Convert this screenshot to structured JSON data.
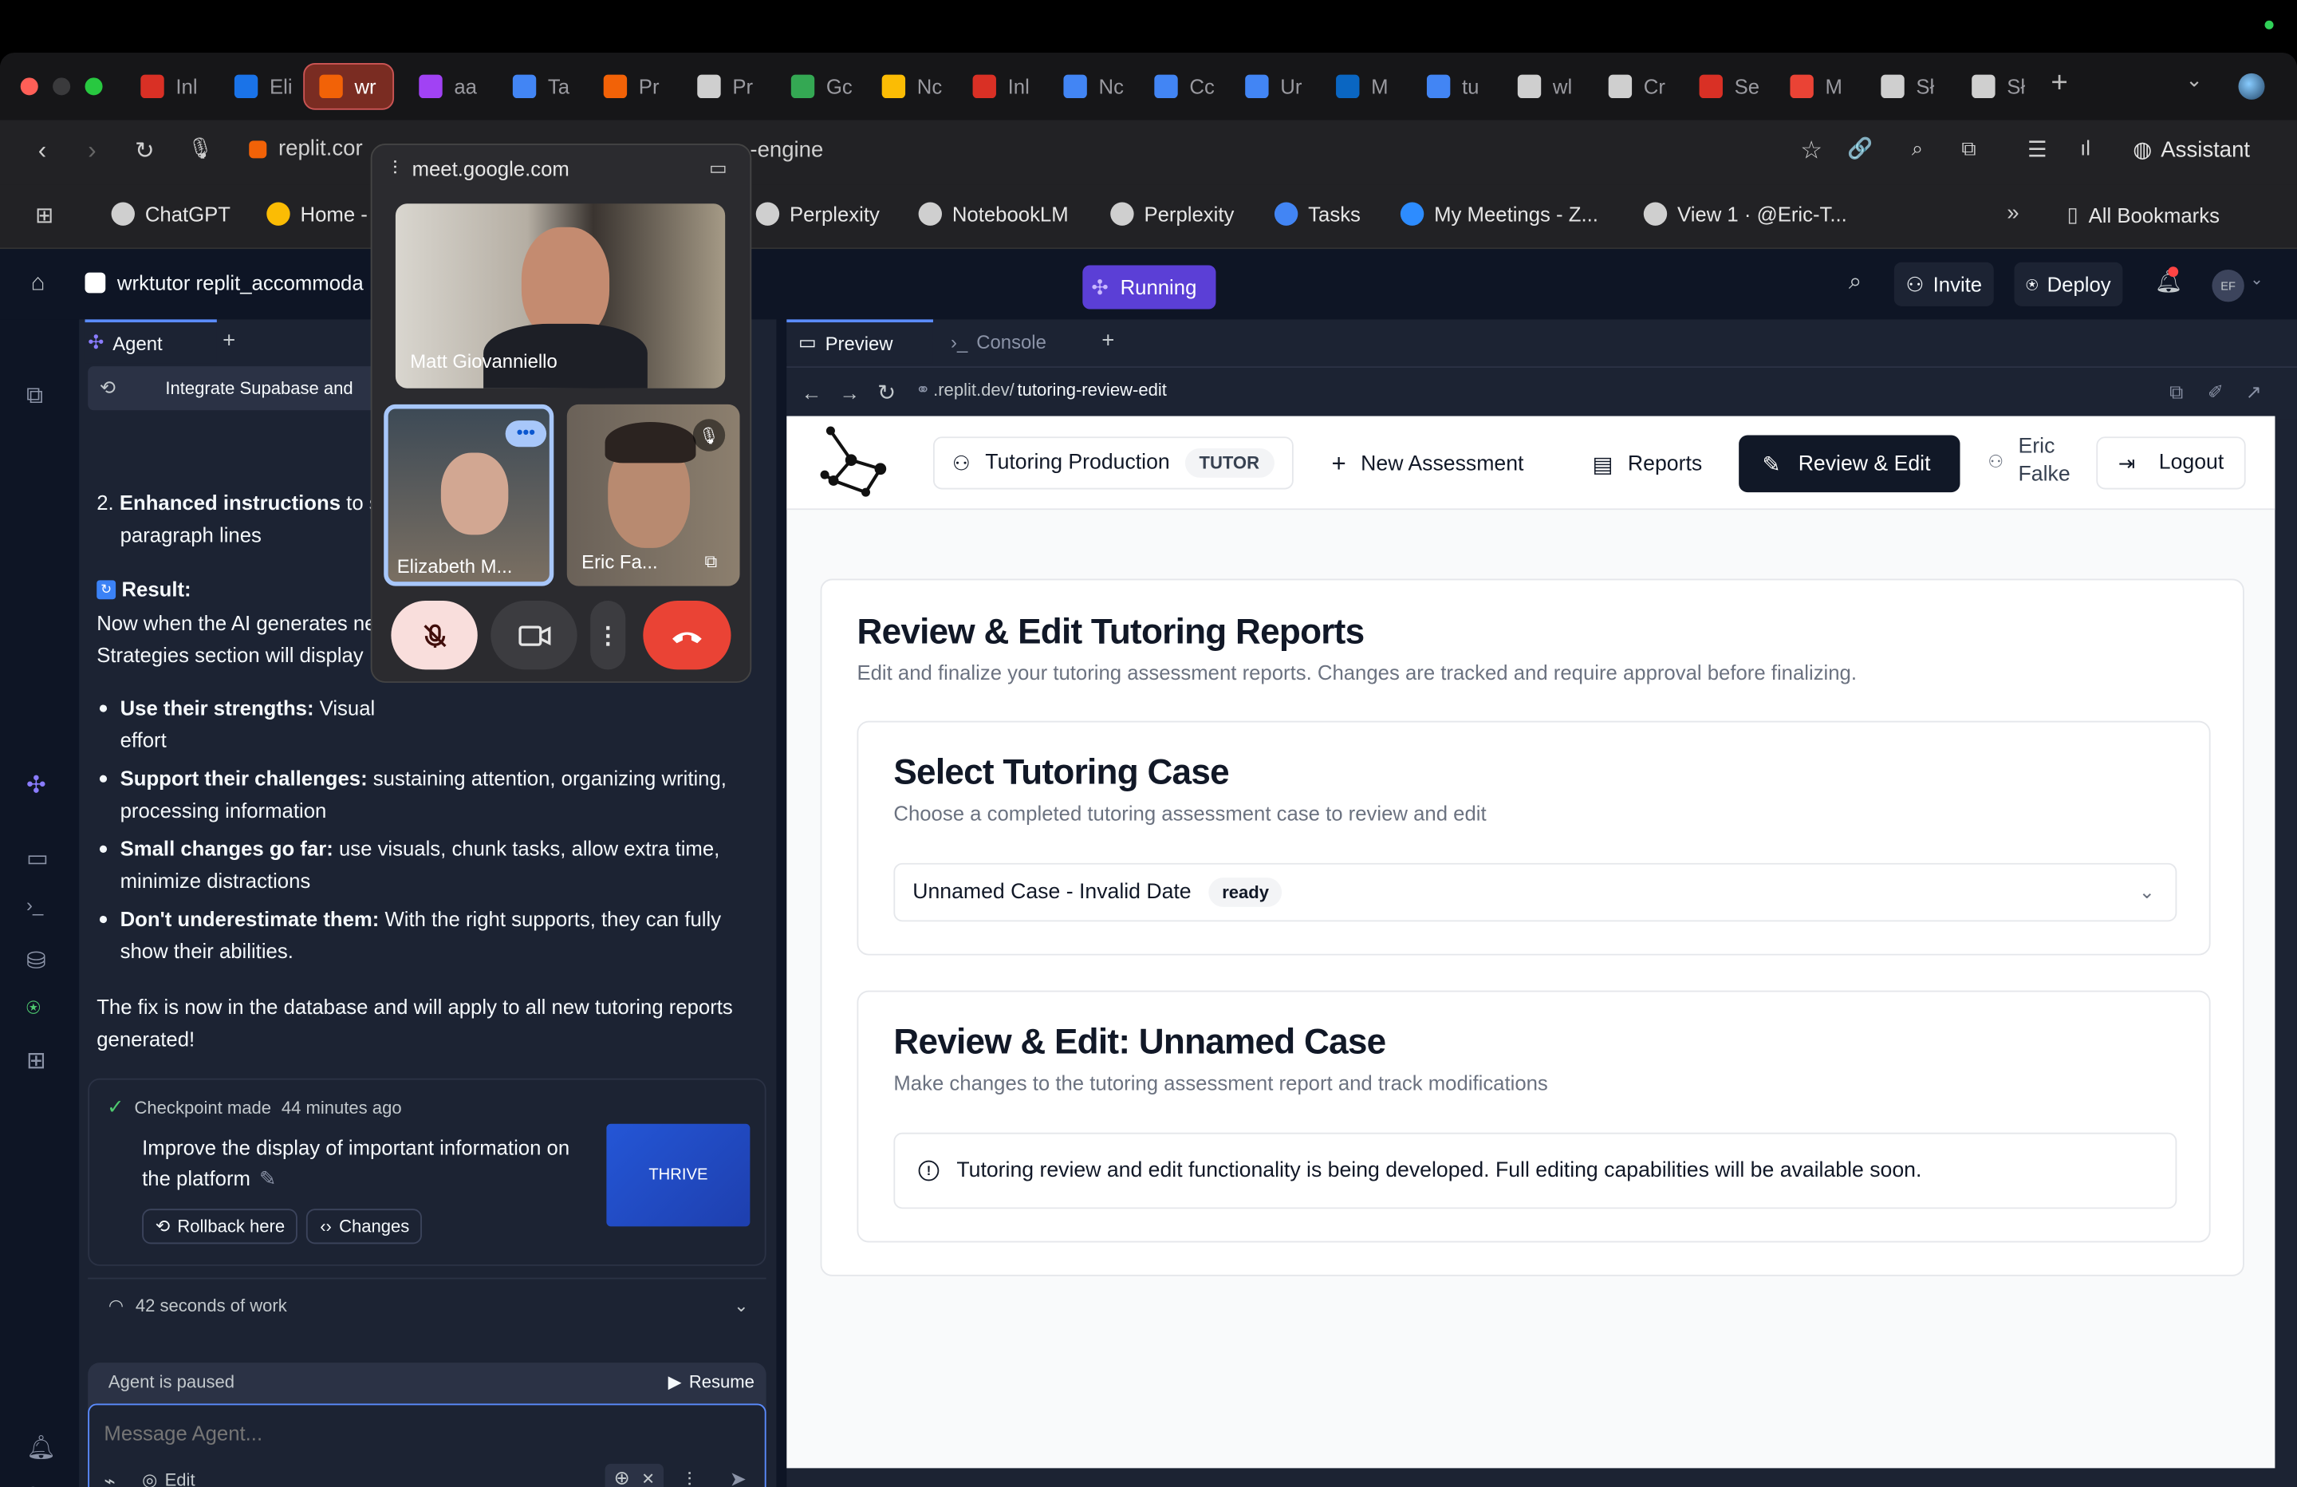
{
  "browser": {
    "tabs": [
      {
        "label": "Inl",
        "color": "#d93025"
      },
      {
        "label": "Eli",
        "color": "#1a73e8"
      },
      {
        "label": "wr",
        "color": "#f26207"
      },
      {
        "label": "aa",
        "color": "#a142f4"
      },
      {
        "label": "Ta",
        "color": "#4285f4"
      },
      {
        "label": "Pr",
        "color": "#f26207"
      },
      {
        "label": "Pr",
        "color": "#cfcfcf"
      },
      {
        "label": "Gc",
        "color": "#34a853"
      },
      {
        "label": "Nc",
        "color": "#fbbc04"
      },
      {
        "label": "Inl",
        "color": "#d93025"
      },
      {
        "label": "Nc",
        "color": "#4285f4"
      },
      {
        "label": "Cc",
        "color": "#4285f4"
      },
      {
        "label": "Ur",
        "color": "#4285f4"
      },
      {
        "label": "M",
        "color": "#0a66c2"
      },
      {
        "label": "tu",
        "color": "#4285f4"
      },
      {
        "label": "wl",
        "color": "#cfcfcf"
      },
      {
        "label": "Cr",
        "color": "#cfcfcf"
      },
      {
        "label": "Se",
        "color": "#d93025"
      },
      {
        "label": "M",
        "color": "#ea4335"
      },
      {
        "label": "Sł",
        "color": "#cfcfcf"
      },
      {
        "label": "Sł",
        "color": "#cfcfcf"
      }
    ],
    "url_left": "replit.cor",
    "url_right": "-engine",
    "assistant": "Assistant",
    "bookmarks": [
      {
        "label": "ChatGPT",
        "color": "#cfcfcf"
      },
      {
        "label": "Home -",
        "color": "#fbbc04"
      },
      {
        "label": "Perplexity",
        "color": "#cfcfcf"
      },
      {
        "label": "NotebookLM",
        "color": "#cfcfcf"
      },
      {
        "label": "Perplexity",
        "color": "#cfcfcf"
      },
      {
        "label": "Tasks",
        "color": "#4285f4"
      },
      {
        "label": "My Meetings - Z...",
        "color": "#2d8cff"
      },
      {
        "label": "View 1 · @Eric-T...",
        "color": "#cfcfcf"
      }
    ],
    "all_bookmarks": "All Bookmarks"
  },
  "replit": {
    "repl_name": "wrktutor replit_accommoda",
    "running": "Running",
    "invite": "Invite",
    "deploy": "Deploy",
    "avatar": "EF",
    "agent_tab": "Agent",
    "preview_tab": "Preview",
    "console_tab": "Console",
    "history_item": "Integrate Supabase and",
    "preview_url_prefix": ".replit.dev/",
    "preview_url_path": "tutoring-review-edit"
  },
  "agent": {
    "item2_bold": "Enhanced instructions",
    "item2_rest": " to s",
    "item2_line2": "paragraph lines",
    "result_label": "Result:",
    "result_line1": "Now when the AI generates ne",
    "result_line2": "Strategies section will display",
    "bullets": [
      {
        "bold": "Use their strengths:",
        "text": " Visual",
        "line2": "effort"
      },
      {
        "bold": "Support their challenges:",
        "text": " sustaining attention, organizing writing,",
        "line2": "processing information"
      },
      {
        "bold": "Small changes go far:",
        "text": " use visuals, chunk tasks, allow extra time,",
        "line2": "minimize distractions"
      },
      {
        "bold": "Don't underestimate them:",
        "text": " With the right supports, they can fully",
        "line2": "show their abilities."
      }
    ],
    "fix_line1": "The fix is now in the database and will apply to all new tutoring reports",
    "fix_line2": "generated!",
    "checkpoint_label": "Checkpoint made",
    "checkpoint_time": "44 minutes ago",
    "checkpoint_desc1": "Improve the display of important information on",
    "checkpoint_desc2": "the platform",
    "rollback": "Rollback here",
    "changes": "Changes",
    "thumb_text": "THRIVE",
    "work_time": "42 seconds of work",
    "paused": "Agent is paused",
    "resume": "Resume",
    "message_placeholder": "Message Agent...",
    "edit": "Edit"
  },
  "meet": {
    "url": "meet.google.com",
    "main_name": "Matt Giovanniello",
    "tile1_name": "Elizabeth M...",
    "tile2_name": "Eric Fa..."
  },
  "app": {
    "production_label": "Tutoring Production",
    "tutor_badge": "TUTOR",
    "new_assessment": "New Assessment",
    "reports": "Reports",
    "review_edit": "Review & Edit",
    "user_first": "Eric",
    "user_last": "Falke",
    "logout": "Logout",
    "page_title": "Review & Edit Tutoring Reports",
    "page_subtitle": "Edit and finalize your tutoring assessment reports. Changes are tracked and require approval before finalizing.",
    "select_title": "Select Tutoring Case",
    "select_subtitle": "Choose a completed tutoring assessment case to review and edit",
    "selected_case": "Unnamed Case - Invalid Date",
    "selected_status": "ready",
    "review_title": "Review & Edit: Unnamed Case",
    "review_subtitle": "Make changes to the tutoring assessment report and track modifications",
    "notice": "Tutoring review and edit functionality is being developed. Full editing capabilities will be available soon."
  },
  "colors": {
    "replit_bg": "#0e1525",
    "replit_panel": "#1c2333",
    "running_bg": "#5b3fd6",
    "active_nav": "#111827",
    "meet_end": "#ea4335"
  }
}
